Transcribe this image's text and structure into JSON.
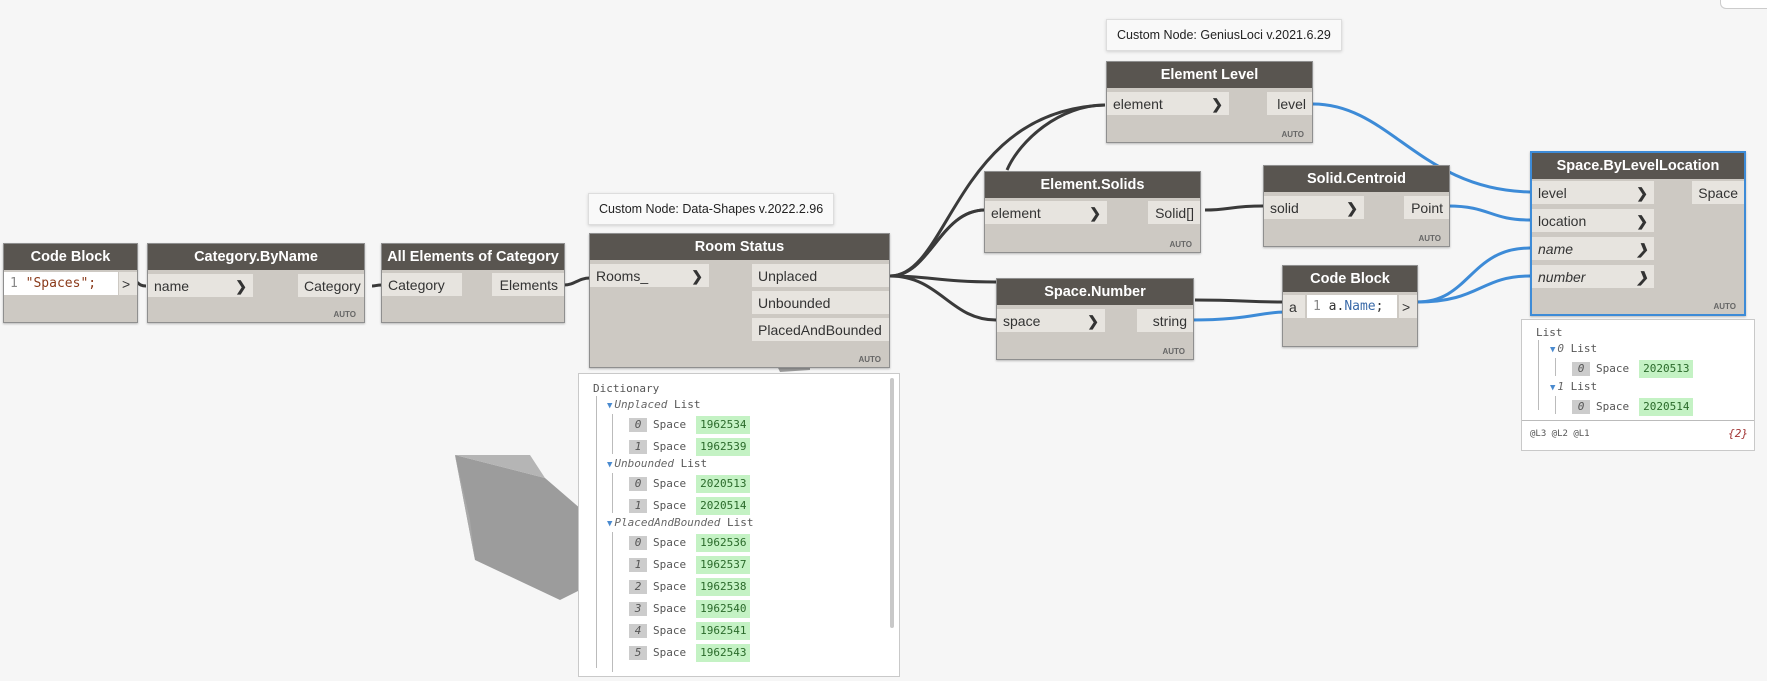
{
  "nodes": {
    "code_block_1": {
      "title": "Code Block",
      "line_no": "1",
      "code": "\"Spaces\";",
      "out": ">"
    },
    "category_by_name": {
      "title": "Category.ByName",
      "in": "name",
      "out": "Category",
      "auto": "AUTO"
    },
    "all_elements": {
      "title": "All Elements of Category",
      "in": "Category",
      "out": "Elements"
    },
    "room_status": {
      "title": "Room Status",
      "in": "Rooms_",
      "outs": [
        "Unplaced",
        "Unbounded",
        "PlacedAndBounded"
      ],
      "auto": "AUTO",
      "tooltip": "Custom Node: Data-Shapes v.2022.2.96"
    },
    "element_level": {
      "title": "Element Level",
      "in": "element",
      "out": "level",
      "auto": "AUTO",
      "tooltip": "Custom Node: GeniusLoci v.2021.6.29"
    },
    "element_solids": {
      "title": "Element.Solids",
      "in": "element",
      "out": "Solid[]",
      "auto": "AUTO"
    },
    "solid_centroid": {
      "title": "Solid.Centroid",
      "in": "solid",
      "out": "Point",
      "auto": "AUTO"
    },
    "space_number": {
      "title": "Space.Number",
      "in": "space",
      "out": "string",
      "auto": "AUTO"
    },
    "code_block_2": {
      "title": "Code Block",
      "in": "a",
      "line_no": "1",
      "code_obj": "a.",
      "code_prop": "Name",
      "code_end": ";",
      "out": ">"
    },
    "space_by_level_location": {
      "title": "Space.ByLevelLocation",
      "ins": [
        "level",
        "location",
        "name",
        "number"
      ],
      "out": "Space",
      "auto": "AUTO"
    }
  },
  "watch_room_status": {
    "root": "Dictionary",
    "groups": [
      {
        "key": "Unplaced",
        "type": "List",
        "items": [
          {
            "idx": "0",
            "type": "Space",
            "val": "1962534"
          },
          {
            "idx": "1",
            "type": "Space",
            "val": "1962539"
          }
        ]
      },
      {
        "key": "Unbounded",
        "type": "List",
        "items": [
          {
            "idx": "0",
            "type": "Space",
            "val": "2020513"
          },
          {
            "idx": "1",
            "type": "Space",
            "val": "2020514"
          }
        ]
      },
      {
        "key": "PlacedAndBounded",
        "type": "List",
        "items": [
          {
            "idx": "0",
            "type": "Space",
            "val": "1962536"
          },
          {
            "idx": "1",
            "type": "Space",
            "val": "1962537"
          },
          {
            "idx": "2",
            "type": "Space",
            "val": "1962538"
          },
          {
            "idx": "3",
            "type": "Space",
            "val": "1962540"
          },
          {
            "idx": "4",
            "type": "Space",
            "val": "1962541"
          },
          {
            "idx": "5",
            "type": "Space",
            "val": "1962543"
          }
        ]
      }
    ]
  },
  "watch_space": {
    "root": "List",
    "groups": [
      {
        "idx": "0",
        "type": "List",
        "items": [
          {
            "idx": "0",
            "type": "Space",
            "val": "2020513"
          }
        ]
      },
      {
        "idx": "1",
        "type": "List",
        "items": [
          {
            "idx": "0",
            "type": "Space",
            "val": "2020514"
          }
        ]
      }
    ],
    "levels": "@L3 @L2 @L1",
    "count": "{2}"
  },
  "colors": {
    "wire_dark": "#3a3a3a",
    "wire_blue": "#3d8bd7",
    "node_header": "#595550",
    "node_body": "#cdc9c3",
    "value_bg": "#c4f2c4"
  }
}
